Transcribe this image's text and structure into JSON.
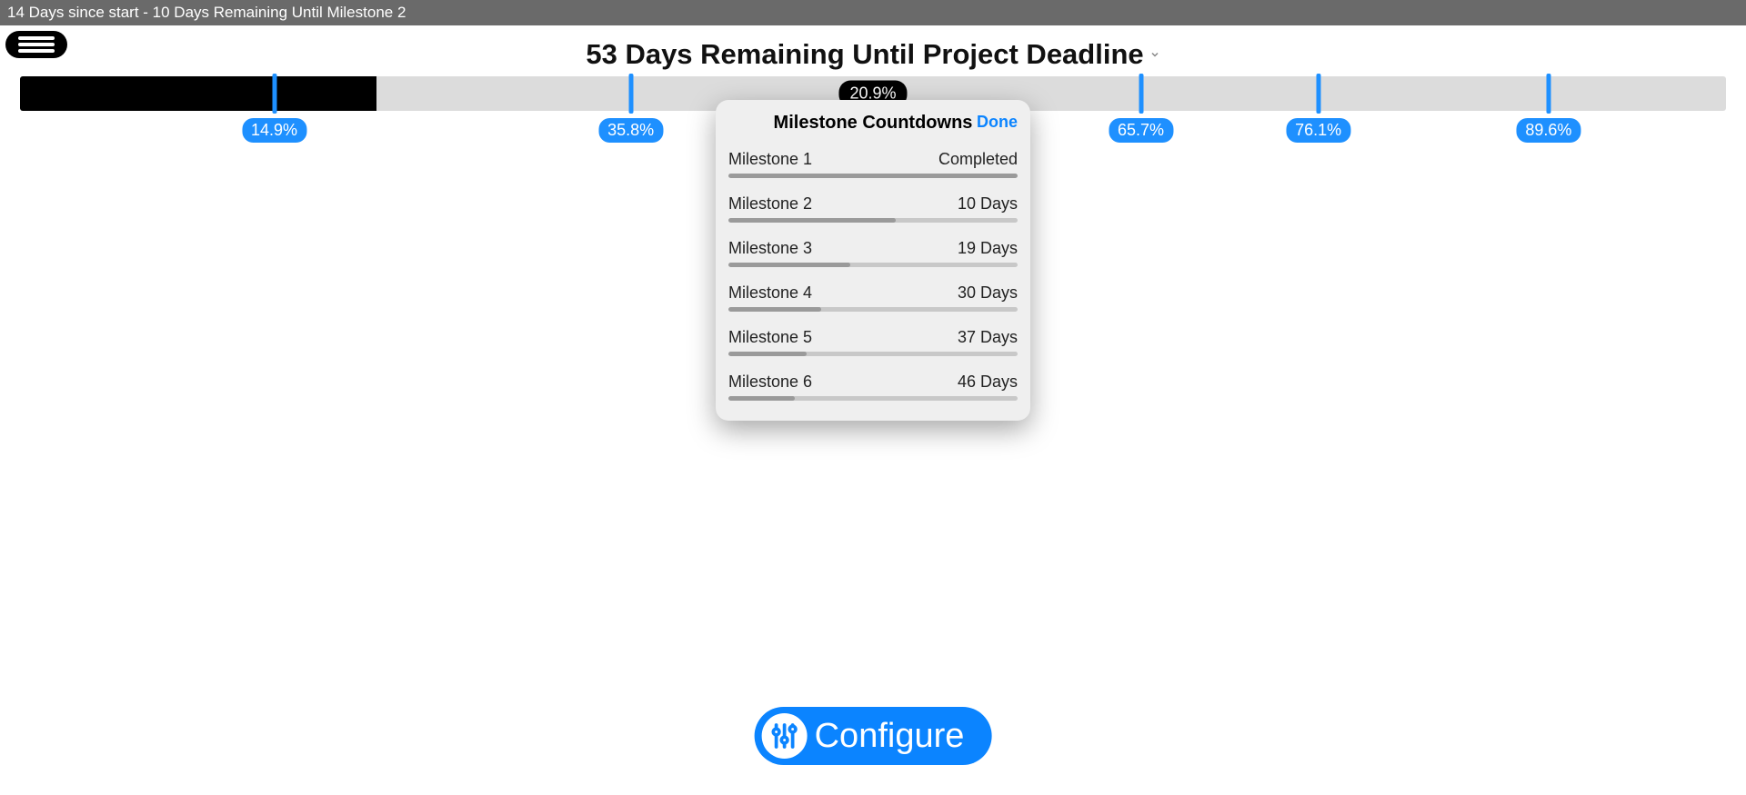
{
  "title_bar": "14 Days since start - 10 Days Remaining Until Milestone 2",
  "heading": "53 Days Remaining Until Project Deadline",
  "progress": {
    "percent_fill": 20.9,
    "badge_label": "20.9%",
    "badge_position": 50.0
  },
  "ticks": [
    {
      "pos": 14.9,
      "label": "14.9%"
    },
    {
      "pos": 35.8,
      "label": "35.8%"
    },
    {
      "pos": 65.7,
      "label": "65.7%"
    },
    {
      "pos": 76.1,
      "label": "76.1%"
    },
    {
      "pos": 89.6,
      "label": "89.6%"
    }
  ],
  "popover": {
    "title": "Milestone Countdowns",
    "done_label": "Done",
    "items": [
      {
        "name": "Milestone 1",
        "value": "Completed",
        "fill": 100
      },
      {
        "name": "Milestone 2",
        "value": "10 Days",
        "fill": 58
      },
      {
        "name": "Milestone 3",
        "value": "19 Days",
        "fill": 42
      },
      {
        "name": "Milestone 4",
        "value": "30 Days",
        "fill": 32
      },
      {
        "name": "Milestone 5",
        "value": "37 Days",
        "fill": 27
      },
      {
        "name": "Milestone 6",
        "value": "46 Days",
        "fill": 23
      }
    ]
  },
  "configure_label": "Configure"
}
